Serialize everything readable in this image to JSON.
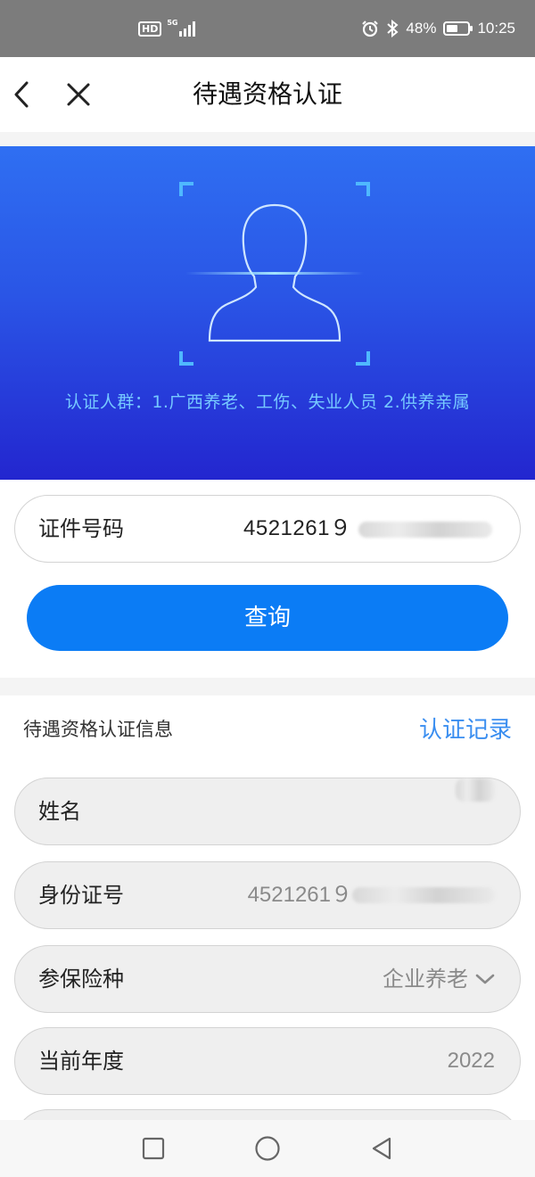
{
  "status_bar": {
    "hd_badge": "HD",
    "network": "5G",
    "battery": "48%",
    "time": "10:25",
    "icons": [
      "hd-icon",
      "signal-icon",
      "alarm-icon",
      "bluetooth-icon",
      "battery-icon"
    ]
  },
  "nav": {
    "title": "待遇资格认证",
    "back_icon": "chevron-left-icon",
    "close_icon": "close-icon"
  },
  "banner": {
    "caption": "认证人群：1.广西养老、工伤、失业人员    2.供养亲属",
    "icon": "face-scan-icon"
  },
  "query": {
    "id_label": "证件号码",
    "id_value": "4521261９",
    "button_label": "查询"
  },
  "info": {
    "section_title": "待遇资格认证信息",
    "record_link": "认证记录",
    "rows": [
      {
        "label": "姓名",
        "value": ""
      },
      {
        "label": "身份证号",
        "value": "4521261９"
      },
      {
        "label": "参保险种",
        "value": "企业养老"
      },
      {
        "label": "当前年度",
        "value": "2022"
      }
    ]
  },
  "system_nav": {
    "icons": [
      "recent-apps-icon",
      "home-icon",
      "back-triangle-icon"
    ]
  }
}
